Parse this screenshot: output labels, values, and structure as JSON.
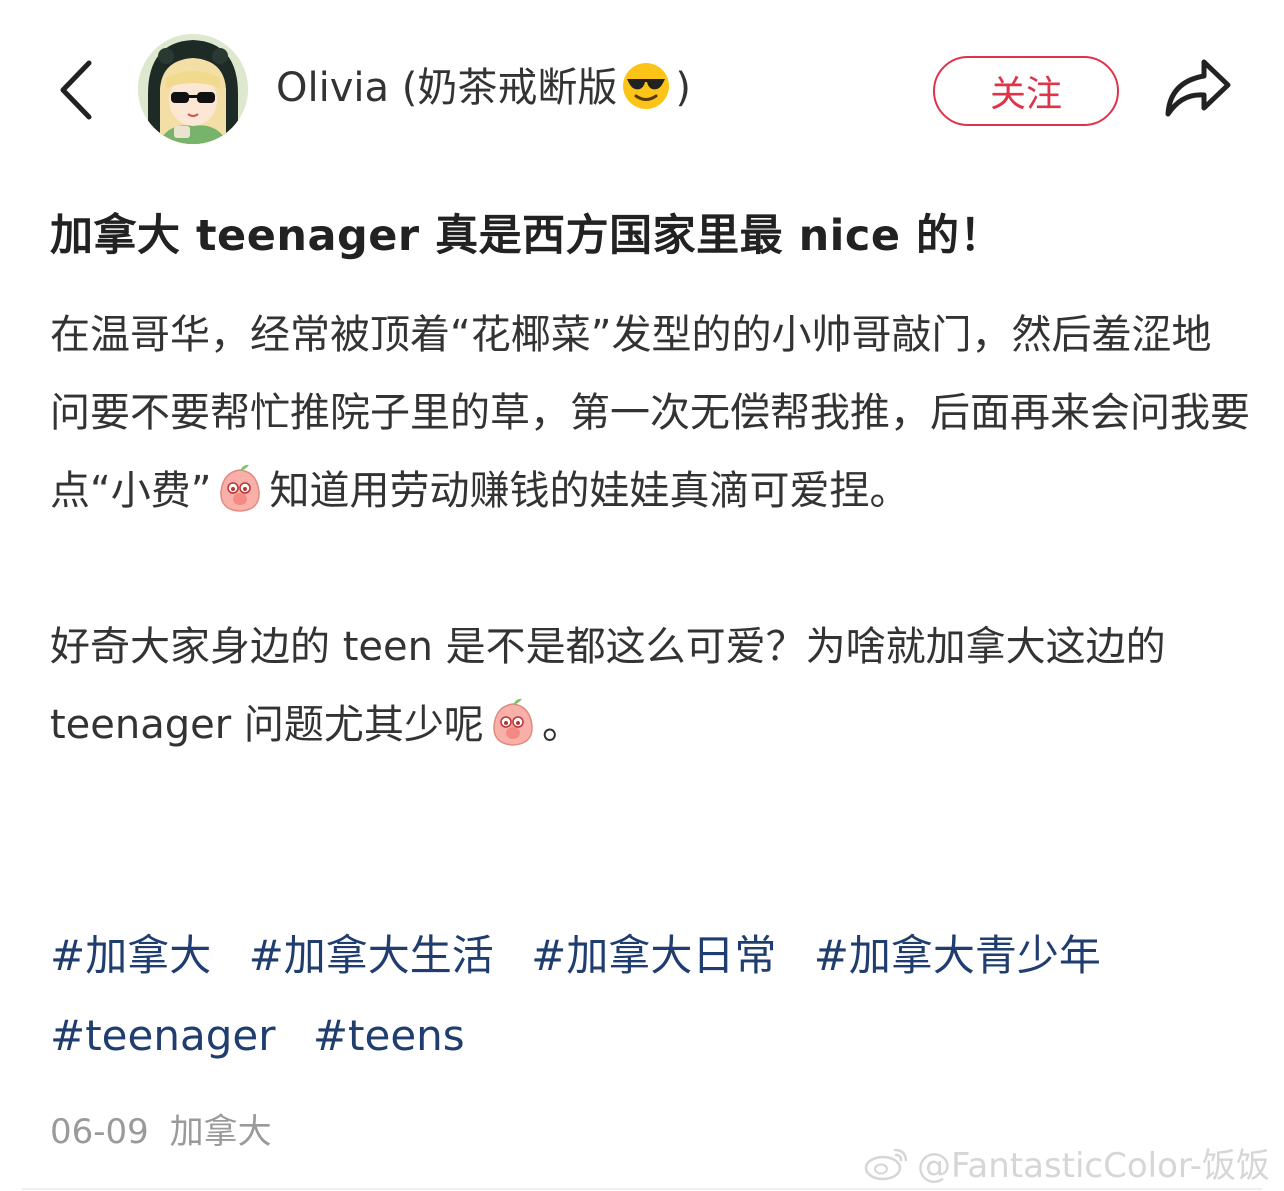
{
  "header": {
    "author_name_prefix": "Olivia (奶茶戒断版",
    "author_name_suffix": ")",
    "author_emoji": "smiling-face-with-sunglasses",
    "follow_label": "关注",
    "accent_color": "#e0334a"
  },
  "post": {
    "title": "加拿大 teenager 真是西方国家里最 nice 的！",
    "paragraph1_part1": "在温哥华，经常被顶着“花椰菜”发型的的小帅哥敲门，然后羞涩地问要不要帮忙推院子里的草，第一次无偿帮我推，后面再来会问我要点“小费”",
    "paragraph1_part2": "知道用劳动赚钱的娃娃真滴可爱捏。",
    "paragraph2_part1": "好奇大家身边的 teen 是不是都这么可爱？为啥就加拿大这边的 teenager 问题尤其少呢",
    "paragraph2_part2": "。",
    "inline_emoji": "peach-blush-emoji"
  },
  "tags": [
    "#加拿大",
    "#加拿大生活",
    "#加拿大日常",
    "#加拿大青少年",
    "#teenager",
    "#teens"
  ],
  "tag_color": "#1f3d6f",
  "meta": {
    "date": "06-09",
    "location": "加拿大"
  },
  "watermark": {
    "text": "@FantasticColor-饭饭",
    "icon": "weibo-icon"
  }
}
